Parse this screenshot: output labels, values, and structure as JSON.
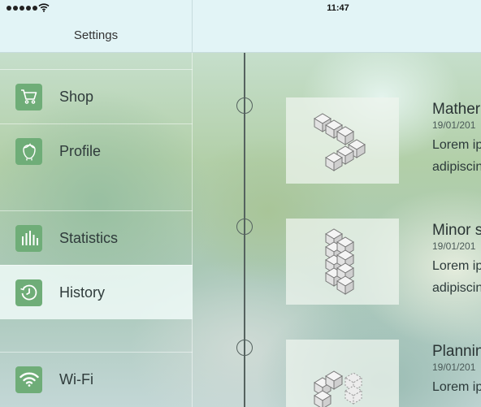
{
  "status_bar": {
    "time": "11:47"
  },
  "nav": {
    "title": "Settings"
  },
  "sidebar": {
    "items": [
      {
        "label": "Shop",
        "icon": "cart-icon"
      },
      {
        "label": "Profile",
        "icon": "user-face-icon"
      },
      {
        "label": "Statistics",
        "icon": "bar-chart-icon"
      },
      {
        "label": "History",
        "icon": "history-clock-icon",
        "active": true
      },
      {
        "label": "Wi-Fi",
        "icon": "wifi-icon"
      }
    ]
  },
  "timeline": {
    "entries": [
      {
        "title": "Mather",
        "date": "19/01/201",
        "line1": "Lorem ip",
        "line2": "adipiscin"
      },
      {
        "title": "Minor s",
        "date": "19/01/201",
        "line1": "Lorem ip",
        "line2": "adipiscin"
      },
      {
        "title": "Plannin",
        "date": "19/01/201",
        "line1": "Lorem ip"
      }
    ]
  },
  "colors": {
    "accent": "#6fad78",
    "bar": "#e2f4f6",
    "timeline": "#55625f"
  }
}
